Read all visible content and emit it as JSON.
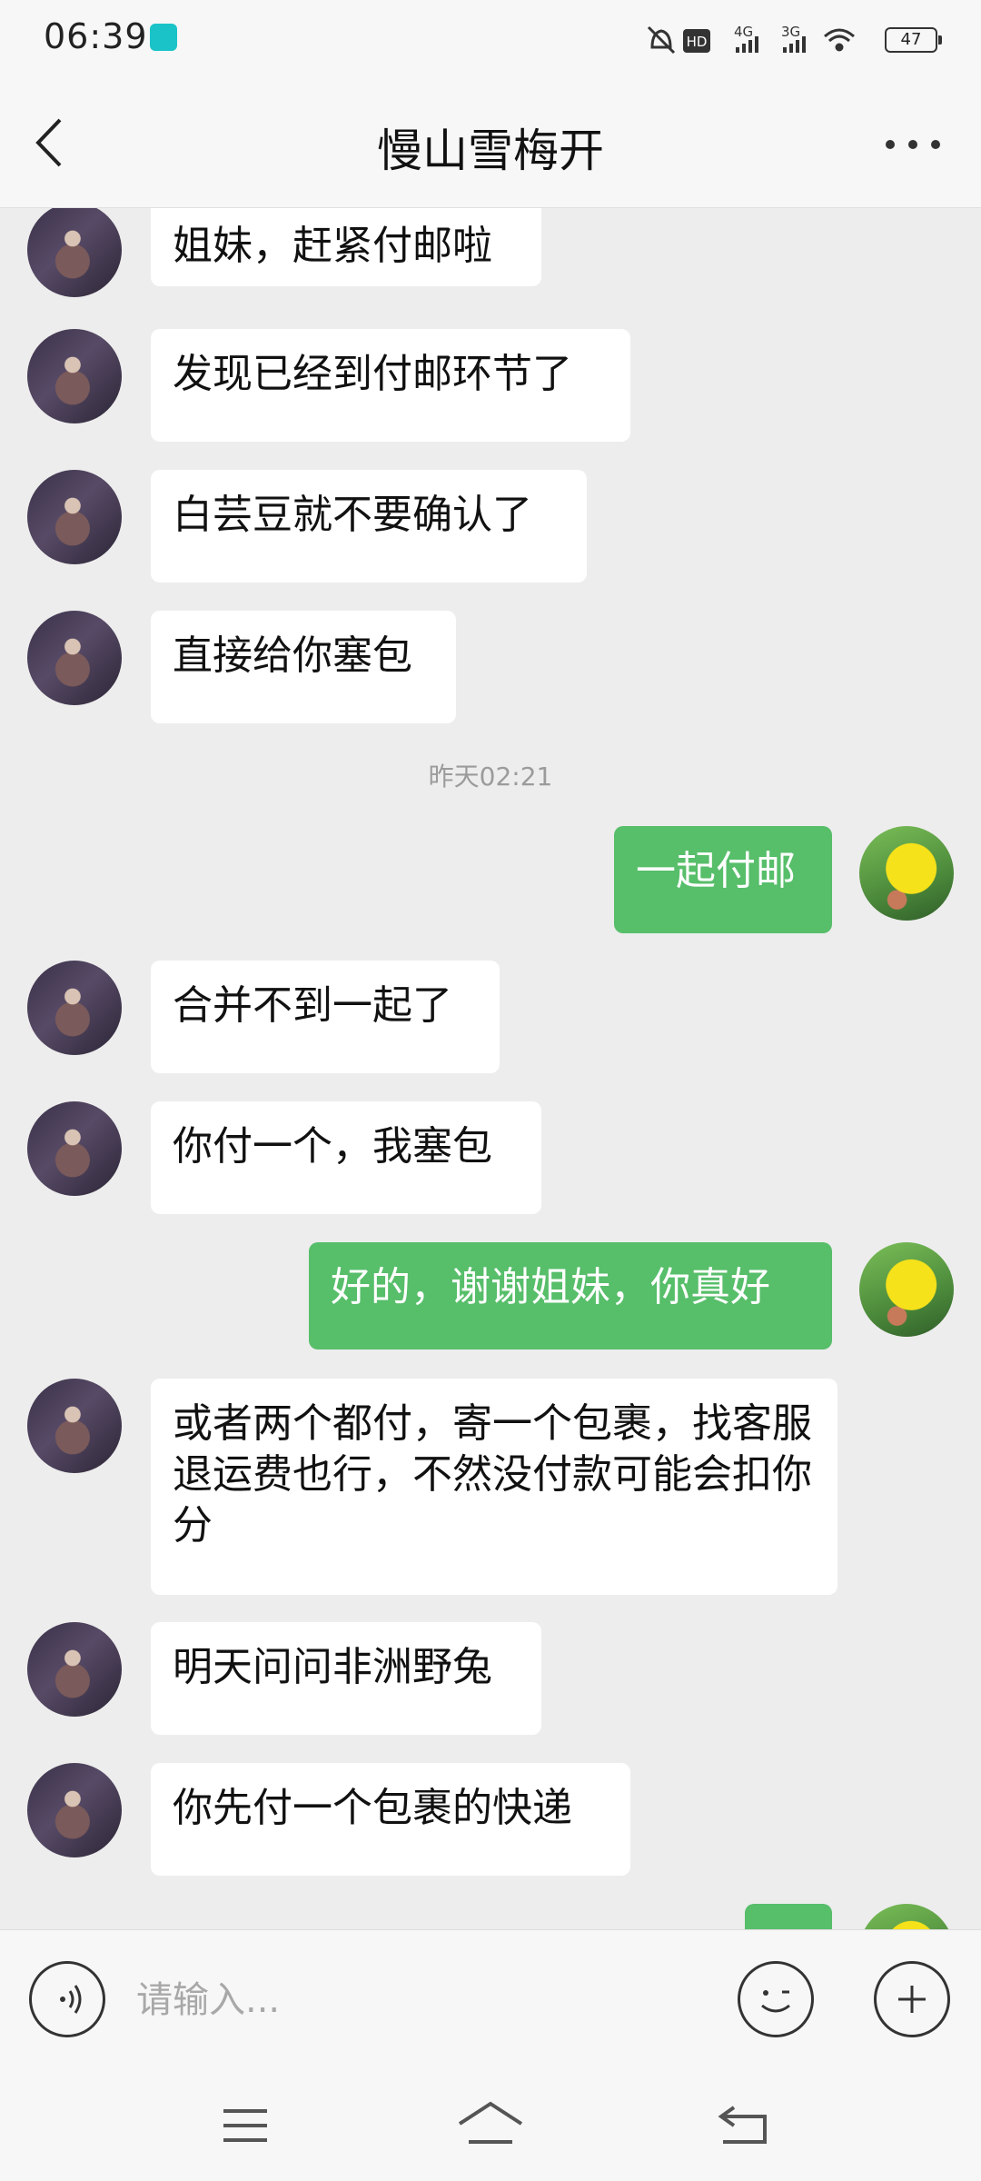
{
  "status_bar": {
    "time": "06:39",
    "battery": "47",
    "network_1": "4G",
    "network_2": "3G",
    "hd": "HD"
  },
  "header": {
    "title": "慢山雪梅开"
  },
  "messages": [
    {
      "side": "in",
      "text": "姐妹，赶紧付邮啦"
    },
    {
      "side": "in",
      "text": "发现已经到付邮环节了"
    },
    {
      "side": "in",
      "text": "白芸豆就不要确认了"
    },
    {
      "side": "in",
      "text": "直接给你塞包"
    },
    {
      "timestamp": "昨天02:21"
    },
    {
      "side": "out",
      "text": "一起付邮"
    },
    {
      "side": "in",
      "text": "合并不到一起了"
    },
    {
      "side": "in",
      "text": "你付一个，我塞包"
    },
    {
      "side": "out",
      "text": "好的，谢谢姐妹，你真好"
    },
    {
      "side": "in",
      "text": "或者两个都付，寄一个包裹，找客服退运费也行，不然没付款可能会扣你分"
    },
    {
      "side": "in",
      "text": "明天问问非洲野兔"
    },
    {
      "side": "in",
      "text": "你先付一个包裹的快递"
    }
  ],
  "input": {
    "placeholder": "请输入..."
  },
  "icons": {
    "back": "chevron-left-icon",
    "more": "more-dots-icon",
    "voice": "voice-icon",
    "emoji": "emoji-icon",
    "plus": "plus-icon",
    "nav_menu": "menu-icon",
    "nav_home": "home-icon",
    "nav_back": "back-icon"
  },
  "colors": {
    "outgoing_bubble": "#57be6a",
    "incoming_bubble": "#ffffff",
    "background": "#ededed"
  }
}
